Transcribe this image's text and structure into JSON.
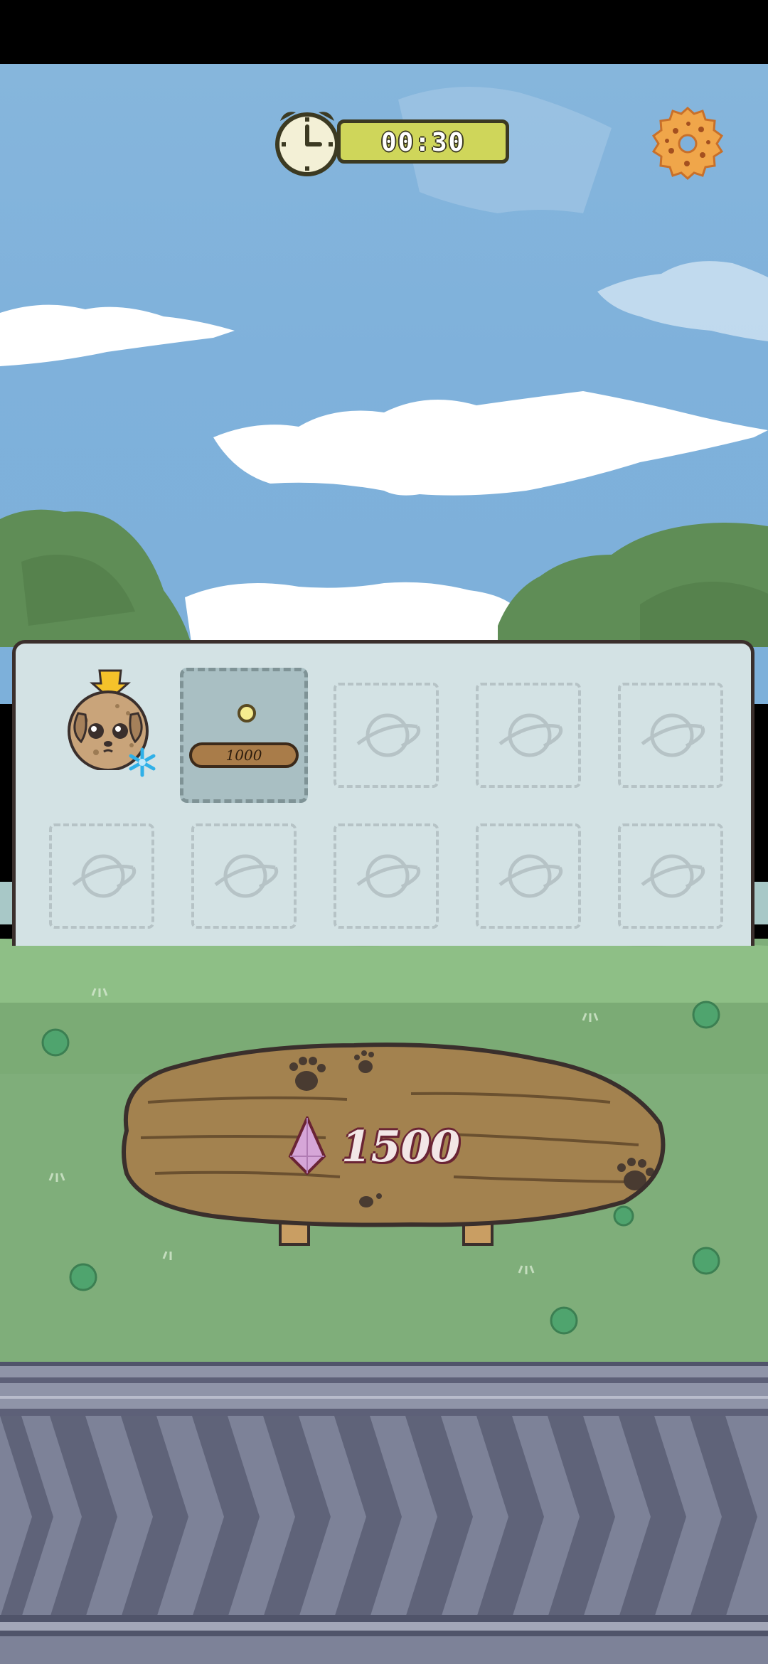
{
  "hud": {
    "timer_text": "00:30",
    "timer_icon": "alarm-clock-icon",
    "settings_icon": "cookie-gear-icon"
  },
  "inventory": {
    "character_icon": "dog-cookie-character",
    "frozen_badge_icon": "snowflake-icon",
    "selected_slot": {
      "icon": "coin-icon",
      "price": "1000"
    },
    "empty_slot_icon": "planet-icon",
    "empty_slot_count": 8
  },
  "board": {
    "gem_icon": "gem-icon",
    "gem_value": "1500"
  },
  "colors": {
    "sky": "#7fb1db",
    "grass": "#7fae7a",
    "wood": "#a3824f",
    "panel": "#d3e2e4",
    "timer_bar": "#cfd65a"
  }
}
